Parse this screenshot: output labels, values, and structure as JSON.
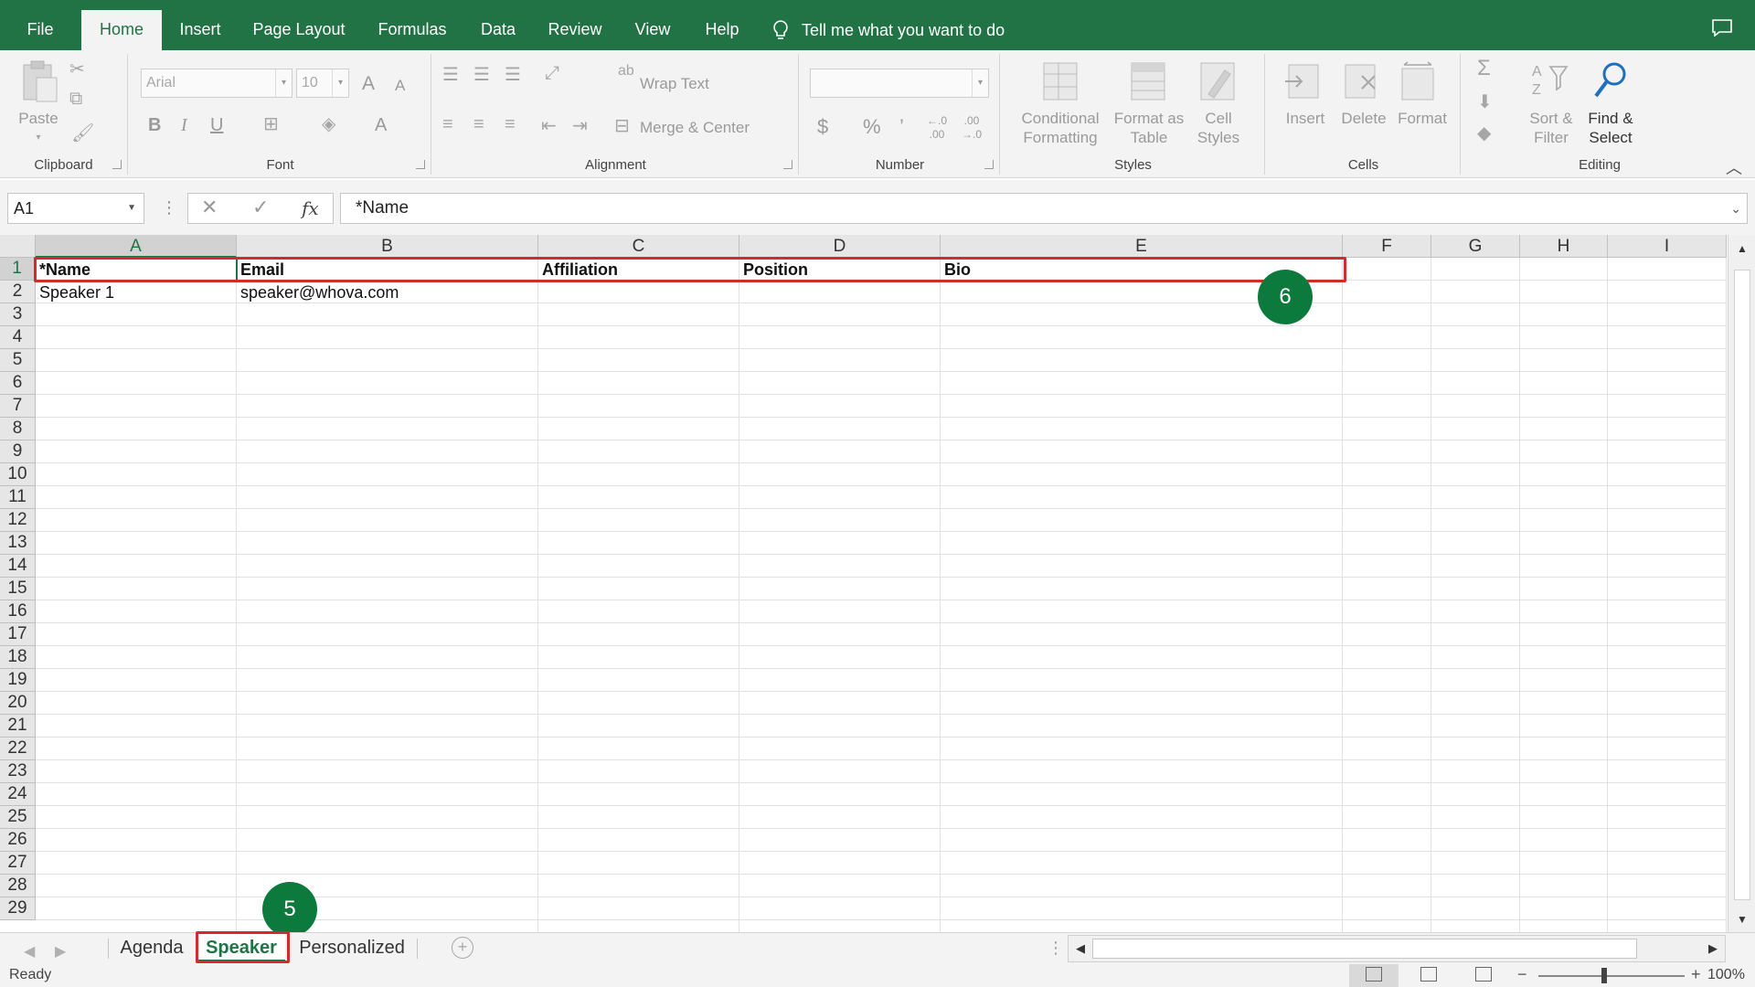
{
  "ribbon_tabs": [
    "File",
    "Home",
    "Insert",
    "Page Layout",
    "Formulas",
    "Data",
    "Review",
    "View",
    "Help"
  ],
  "active_tab": "Home",
  "tell_me": "Tell me what you want to do",
  "ribbon": {
    "clipboard": {
      "label": "Clipboard",
      "paste": "Paste"
    },
    "font": {
      "label": "Font",
      "font_name": "Arial",
      "font_size": "10",
      "bold": "B",
      "italic": "I",
      "underline": "U",
      "grow": "A",
      "shrink": "A",
      "color": "A"
    },
    "alignment": {
      "label": "Alignment",
      "wrap_text": "Wrap Text",
      "merge_center": "Merge & Center"
    },
    "number": {
      "label": "Number",
      "currency": "$",
      "percent": "%",
      "comma": "’",
      "inc_dec": "←.0\n.00",
      "dec_dec": ".00\n→.0"
    },
    "styles": {
      "label": "Styles",
      "conditional": "Conditional\nFormatting",
      "format_table": "Format as\nTable",
      "cell_styles": "Cell\nStyles"
    },
    "cells": {
      "label": "Cells",
      "insert": "Insert",
      "delete": "Delete",
      "format": "Format"
    },
    "editing": {
      "label": "Editing",
      "sort_filter": "Sort &\nFilter",
      "find_select": "Find &\nSelect"
    }
  },
  "formula_bar": {
    "name_box": "A1",
    "fx": "fx",
    "formula": "*Name"
  },
  "columns": [
    "A",
    "B",
    "C",
    "D",
    "E",
    "F",
    "G",
    "H",
    "I"
  ],
  "rows": [
    "1",
    "2",
    "3",
    "4",
    "5",
    "6",
    "7",
    "8",
    "9",
    "10",
    "11",
    "12",
    "13",
    "14",
    "15",
    "16",
    "17",
    "18",
    "19",
    "20",
    "21",
    "22",
    "23",
    "24",
    "25",
    "26",
    "27",
    "28",
    "29"
  ],
  "cells": {
    "A1": "*Name",
    "B1": "Email",
    "C1": "Affiliation",
    "D1": "Position",
    "E1": "Bio",
    "A2": "Speaker 1",
    "B2": "speaker@whova.com"
  },
  "annotations": {
    "badge_header": "6",
    "badge_tab": "5"
  },
  "sheets": [
    "Agenda",
    "Speaker",
    "Personalized"
  ],
  "active_sheet": "Speaker",
  "status": {
    "text": "Ready",
    "zoom": "100%",
    "zoom_level": 100
  },
  "colors": {
    "accent": "#217346",
    "highlight": "#d32b2b",
    "badge": "#0c7a3d"
  }
}
